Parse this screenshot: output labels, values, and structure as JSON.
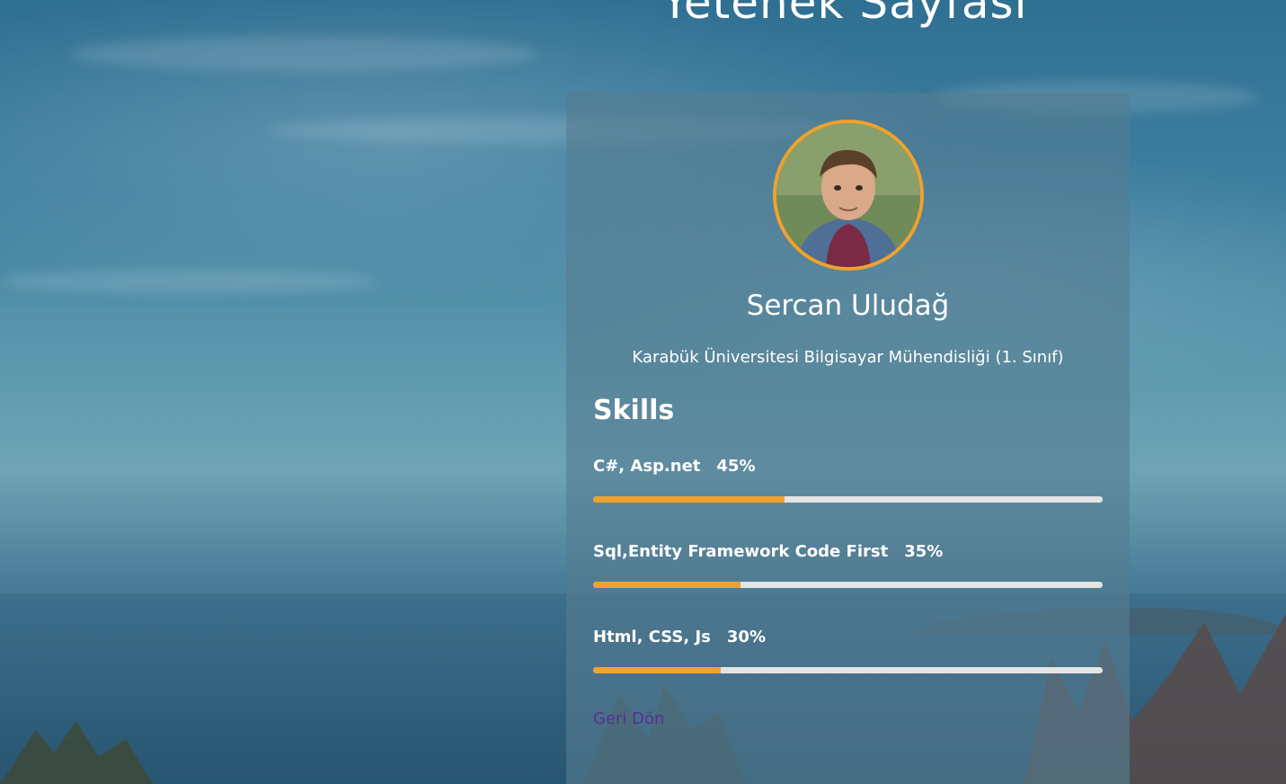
{
  "page": {
    "title": "Yetenek Sayfası"
  },
  "profile": {
    "name": "Sercan Uludağ",
    "school": "Karabük Üniversitesi Bilgisayar Mühendisliği (1. Sınıf)"
  },
  "skills": {
    "heading": "Skills",
    "items": [
      {
        "name": "C#, Asp.net",
        "percent_label": "45%",
        "fill": 0.375
      },
      {
        "name": "Sql,Entity Framework Code First",
        "percent_label": "35%",
        "fill": 0.29
      },
      {
        "name": "Html, CSS, Js",
        "percent_label": "30%",
        "fill": 0.25
      }
    ]
  },
  "nav": {
    "back_label": "Geri Dön"
  },
  "colors": {
    "accent": "#f0a22e",
    "track": "#e4e4e4",
    "link": "#5b2d91"
  }
}
